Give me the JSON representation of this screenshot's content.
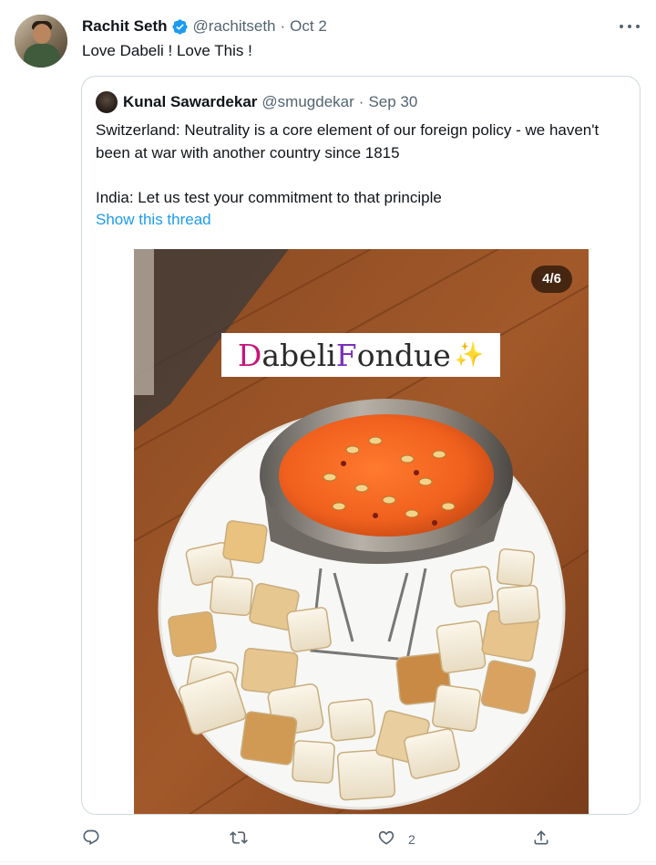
{
  "author": {
    "name": "Rachit Seth",
    "handle": "@rachitseth",
    "date": "Oct 2",
    "text": "Love Dabeli ! Love This !"
  },
  "icons": {
    "verified": "verified-badge-icon",
    "more": "more-options-icon",
    "reply": "reply-icon",
    "retweet": "retweet-icon",
    "like": "like-icon",
    "share": "share-icon"
  },
  "quote": {
    "name": "Kunal Sawardekar",
    "handle": "@smugdekar",
    "date": "Sep 30",
    "line1": "Switzerland: Neutrality is a core element of our foreign policy - we haven't been at war with another country since 1815",
    "line2": "India: Let us test your commitment to that principle",
    "show_thread": "Show this thread",
    "media_counter": "4/6",
    "overlay_d": "D",
    "overlay_abeli": "abeli ",
    "overlay_f": "F",
    "overlay_ondue": "ondue",
    "overlay_sparkle": "✨"
  },
  "actions": {
    "likes": "2"
  },
  "colors": {
    "link": "#1d9bf0",
    "secondary": "#536471",
    "verified": "#1d9bf0"
  }
}
